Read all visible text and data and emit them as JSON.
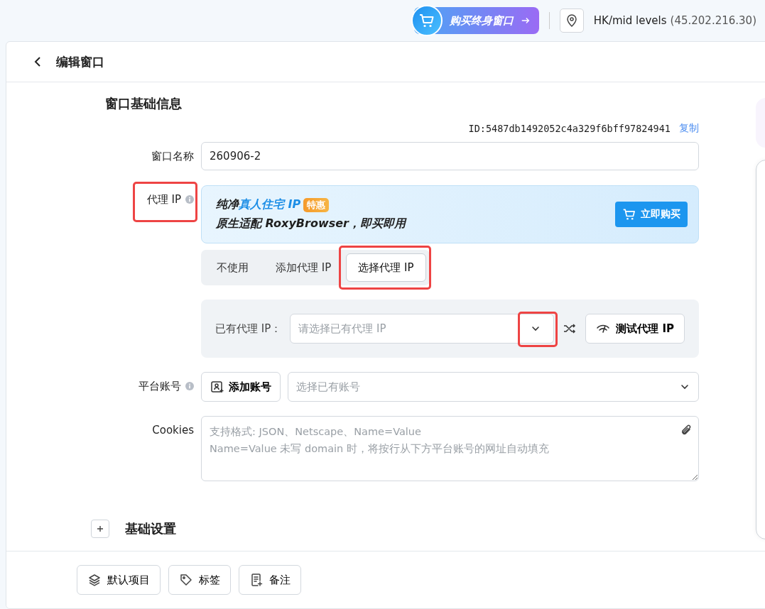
{
  "topbar": {
    "promo_button": "购买终身窗口",
    "location": "HK/mid levels",
    "ip": "(45.202.216.30)"
  },
  "header": {
    "title": "编辑窗口"
  },
  "section_title": "窗口基础信息",
  "id_line": {
    "text": "ID:5487db1492052c4a329f6bff97824941",
    "copy_link": "复制"
  },
  "window_name": {
    "label": "窗口名称",
    "value": "260906-2"
  },
  "proxy": {
    "label": "代理 IP",
    "highlighted": true,
    "banner": {
      "prefix": "纯净",
      "emphasis": "真人住宅 IP",
      "badge": "特惠",
      "line2": "原生适配 RoxyBrowser，即买即用",
      "buy_button": "立即购买"
    },
    "tabs": [
      {
        "label": "不使用",
        "selected": false,
        "highlighted": false
      },
      {
        "label": "添加代理 IP",
        "selected": false,
        "highlighted": false
      },
      {
        "label": "选择代理 IP",
        "selected": true,
        "highlighted": true
      }
    ],
    "existing": {
      "label": "已有代理 IP：",
      "placeholder": "请选择已有代理 IP",
      "caret_highlighted": true,
      "test_button": "测试代理 IP"
    }
  },
  "platform_account": {
    "label": "平台账号",
    "add_button": "添加账号",
    "placeholder": "选择已有账号"
  },
  "cookies": {
    "label": "Cookies",
    "placeholder": "支持格式: JSON、Netscape、Name=Value\nName=Value 未写 domain 时，将按行从下方平台账号的网址自动填充"
  },
  "collapsed_section": {
    "label": "基础设置",
    "expanded": false
  },
  "footer_buttons": [
    {
      "kind": "layers",
      "label": "默认项目"
    },
    {
      "kind": "tag",
      "label": "标签"
    },
    {
      "kind": "note",
      "label": "备注"
    }
  ]
}
